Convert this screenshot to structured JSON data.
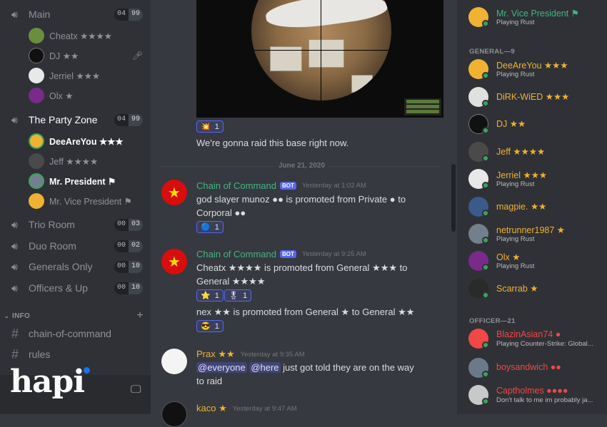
{
  "sidebar": {
    "voice_channels": [
      {
        "name": "Main",
        "count": "04",
        "limit": "99"
      },
      {
        "name": "The Party Zone",
        "count": "04",
        "limit": "99"
      },
      {
        "name": "Trio Room",
        "count": "00",
        "limit": "03"
      },
      {
        "name": "Duo Room",
        "count": "00",
        "limit": "02"
      },
      {
        "name": "Generals Only",
        "count": "00",
        "limit": "10"
      },
      {
        "name": "Officers & Up",
        "count": "00",
        "limit": "10"
      }
    ],
    "main_users": [
      "Cheatx ★★★★",
      "DJ ★★",
      "Jerriel ★★★",
      "Olx ★"
    ],
    "party_users": [
      "DeeAreYou ★★★",
      "Jeff ★★★★",
      "Mr. President ⚑",
      "Mr. Vice President ⚑"
    ],
    "category": "INFO",
    "text_channels": [
      "chain-of-command",
      "rules"
    ],
    "logo": "hapi"
  },
  "chat": {
    "reaction_top": {
      "emoji": "💥",
      "count": "1"
    },
    "message_raid": "We're gonna raid this base right now.",
    "date_divider": "June 21, 2020",
    "messages": [
      {
        "author": "Chain of Command",
        "badge": "BOT",
        "time": "Yesterday at 1:02 AM",
        "text": "god slayer munoz ●● is promoted from Private ● to Corporal ●●",
        "reaction": {
          "emoji": "🔵",
          "count": "1"
        }
      },
      {
        "author": "Chain of Command",
        "badge": "BOT",
        "time": "Yesterday at 9:25 AM",
        "text": "Cheatx ★★★★ is promoted from General ★★★ to General ★★★★",
        "reactions": [
          {
            "emoji": "⭐",
            "count": "1"
          },
          {
            "emoji": "🎖",
            "count": "1"
          }
        ],
        "text2": "nex ★★ is promoted from General ★ to General ★★",
        "reaction2": {
          "emoji": "😎",
          "count": "1"
        }
      },
      {
        "author": "Prax ★★",
        "time": "Yesterday at 9:35 AM",
        "mention1": "@everyone",
        "mention2": "@here",
        "text": "just got told they are on the way",
        "text2": "to raid"
      },
      {
        "author": "kaco ★",
        "time": "Yesterday at 9:47 AM"
      }
    ]
  },
  "members": {
    "top": {
      "name": "Mr. Vice President ⚑",
      "activity": "Playing Rust"
    },
    "general_header": "GENERAL—9",
    "general": [
      {
        "name": "DeeAreYou ★★★",
        "activity": "Playing Rust"
      },
      {
        "name": "DiRK-WiED ★★★",
        "activity": ""
      },
      {
        "name": "DJ ★★",
        "activity": ""
      },
      {
        "name": "Jeff ★★★★",
        "activity": ""
      },
      {
        "name": "Jerriel ★★★",
        "activity": "Playing Rust"
      },
      {
        "name": "magpie. ★★",
        "activity": ""
      },
      {
        "name": "netrunner1987 ★",
        "activity": "Playing Rust"
      },
      {
        "name": "Olx ★",
        "activity": "Playing Rust"
      },
      {
        "name": "Scarrab ★",
        "activity": ""
      }
    ],
    "officer_header": "OFFICER—21",
    "officers": [
      {
        "name": "BlazinAsian74 ●",
        "activity": "Playing Counter-Strike: Global..."
      },
      {
        "name": "boysandwich ●●",
        "activity": ""
      },
      {
        "name": "Captholmes ●●●●",
        "activity": "Don't talk to me im probably ja..."
      }
    ]
  },
  "colors": {
    "accent": "#5865f2",
    "online": "#3ba55d",
    "general_gold": "#f0b232",
    "officer_red": "#f04747",
    "president_green": "#43b581"
  }
}
